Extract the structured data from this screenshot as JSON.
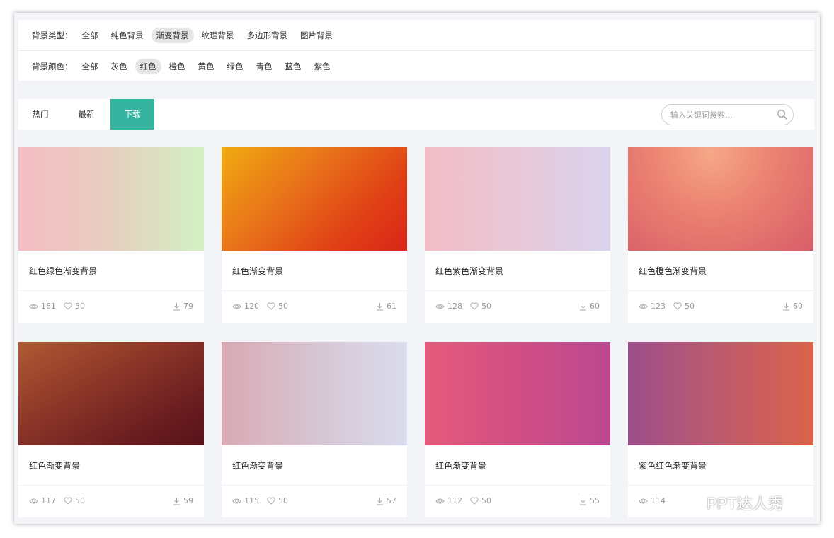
{
  "filters": {
    "type_label": "背景类型：",
    "types": [
      "全部",
      "纯色背景",
      "渐变背景",
      "纹理背景",
      "多边形背景",
      "图片背景"
    ],
    "types_active": "渐变背景",
    "color_label": "背景颜色：",
    "colors": [
      "全部",
      "灰色",
      "红色",
      "橙色",
      "黄色",
      "绿色",
      "青色",
      "蓝色",
      "紫色"
    ],
    "colors_active": "红色"
  },
  "tabs": [
    {
      "label": "热门"
    },
    {
      "label": "最新"
    },
    {
      "label": "下载",
      "active": true
    }
  ],
  "search": {
    "placeholder": "输入关键词搜索..."
  },
  "cards": [
    {
      "title": "红色绿色渐变背景",
      "views": "161",
      "likes": "50",
      "downloads": "79",
      "gradient": "linear-gradient(90deg, #f5bcc3 0%, #e8ccc0 45%, #d2f0c2 100%)"
    },
    {
      "title": "红色渐变背景",
      "views": "120",
      "likes": "50",
      "downloads": "61",
      "gradient": "linear-gradient(135deg, #f0aa10 0%, #e8701a 40%, #e03d15 75%, #d9261a 100%)"
    },
    {
      "title": "红色紫色渐变背景",
      "views": "128",
      "likes": "50",
      "downloads": "60",
      "gradient": "linear-gradient(90deg, #f2bcc5 0%, #e8c8d8 50%, #dad4ee 100%)"
    },
    {
      "title": "红色橙色渐变背景",
      "views": "123",
      "likes": "50",
      "downloads": "60",
      "gradient": "radial-gradient(ellipse at 45% 5%, #f6a888 0%, #ec8472 40%, #d85d68 100%)"
    },
    {
      "title": "红色渐变背景",
      "views": "117",
      "likes": "50",
      "downloads": "59",
      "gradient": "linear-gradient(150deg, #b05a34 0%, #8d3728 40%, #6c1e20 75%, #58121a 100%)"
    },
    {
      "title": "红色渐变背景",
      "views": "115",
      "likes": "50",
      "downloads": "57",
      "gradient": "linear-gradient(90deg, #d8aab4 0%, #d7c5d2 50%, #d9dcee 100%)"
    },
    {
      "title": "红色渐变背景",
      "views": "112",
      "likes": "50",
      "downloads": "55",
      "gradient": "linear-gradient(90deg, #e45a7a 0%, #d24f84 50%, #bb4790 100%)"
    },
    {
      "title": "紫色红色渐变背景",
      "views": "114",
      "likes": "",
      "downloads": "",
      "gradient": "linear-gradient(90deg, #9c4f8b 0%, #bb5a70 45%, #dc624a 100%)"
    }
  ],
  "watermark": {
    "text": "PPT达人秀",
    "icon": "wechat-icon"
  },
  "colors": {
    "accent": "#37b49f",
    "page_bg": "#f3f4f8",
    "meta_text": "#999999"
  }
}
